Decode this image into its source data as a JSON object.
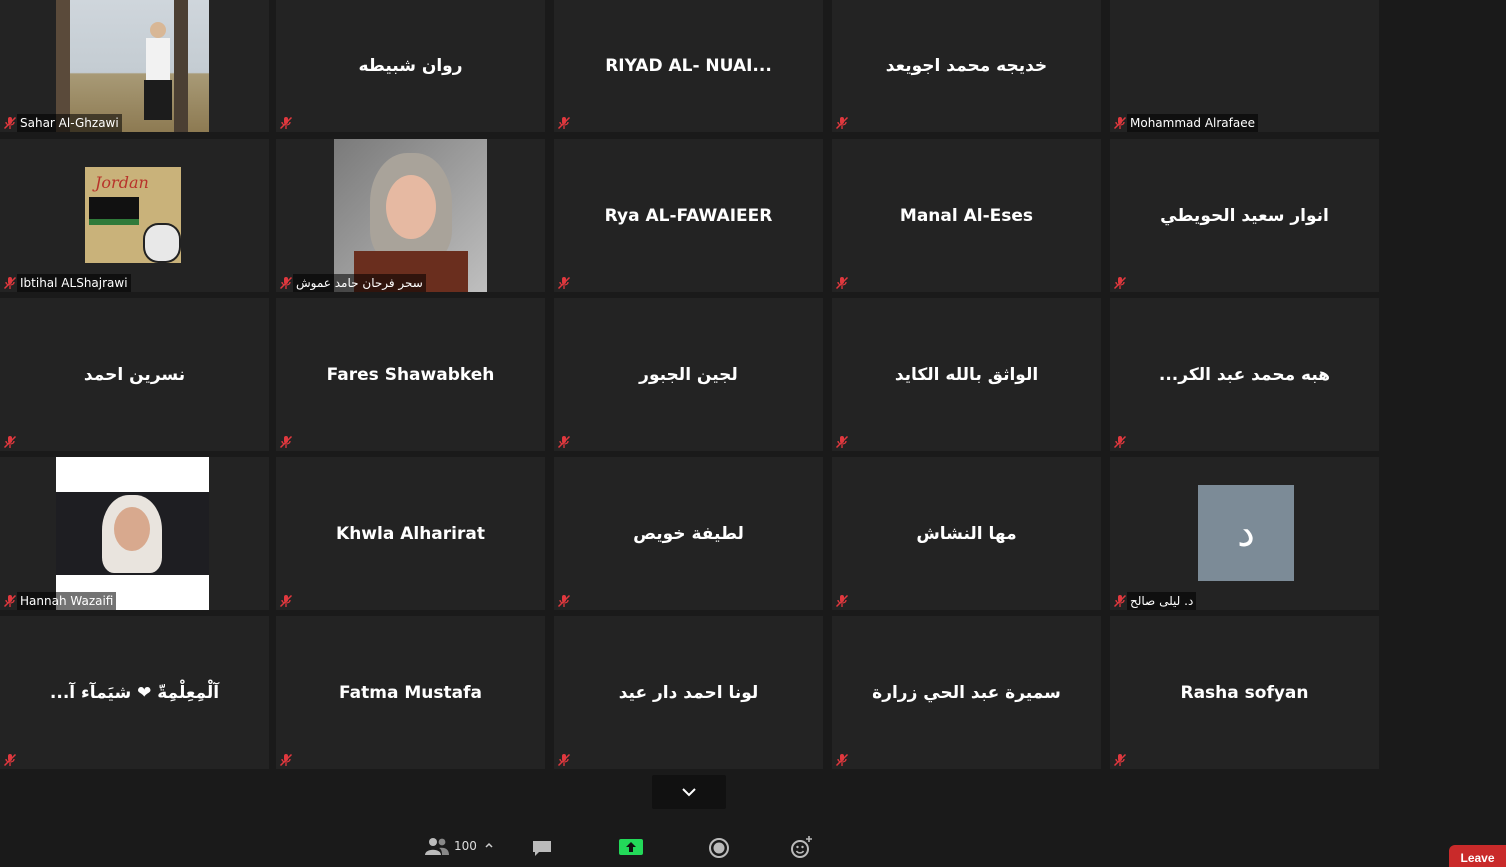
{
  "participants": [
    {
      "name": "Sahar Al-Ghzawi",
      "kind": "video"
    },
    {
      "name": "روان شبيطه",
      "kind": "name"
    },
    {
      "name": "RIYAD  AL-  NUAI...",
      "kind": "name"
    },
    {
      "name": "خديجه محمد اجويعد",
      "kind": "name"
    },
    {
      "name": "Mohammad Alrafaee",
      "kind": "video"
    },
    {
      "name": "Ibtihal ALShajrawi",
      "kind": "video"
    },
    {
      "name": "سحر فرحان حامد عموش",
      "kind": "video"
    },
    {
      "name": "Rya AL-FAWAIEER",
      "kind": "name"
    },
    {
      "name": "Manal Al-Eses",
      "kind": "name"
    },
    {
      "name": "انوار سعيد الحويطي",
      "kind": "name"
    },
    {
      "name": "نسرين احمد",
      "kind": "name"
    },
    {
      "name": "Fares Shawabkeh",
      "kind": "name"
    },
    {
      "name": "لجين الجبور",
      "kind": "name"
    },
    {
      "name": "الواثق بالله  الكايد",
      "kind": "name"
    },
    {
      "name": "...هبه محمد عبد الكر",
      "kind": "name"
    },
    {
      "name": "Hannah Wazaifi",
      "kind": "video"
    },
    {
      "name": "Khwla Alharirat",
      "kind": "name"
    },
    {
      "name": "لطيفة خويص",
      "kind": "name"
    },
    {
      "name": "مها النشاش",
      "kind": "name"
    },
    {
      "name": "د. ليلى صالح",
      "kind": "avatar",
      "avatar_letter": "د"
    },
    {
      "name": "...آلْمِعِلْمِةّ ❤ شيَمآء آ",
      "kind": "name"
    },
    {
      "name": "Fatma Mustafa",
      "kind": "name"
    },
    {
      "name": "لونا احمد دار عيد",
      "kind": "name"
    },
    {
      "name": "سميرة عبد الحي زرارة",
      "kind": "name"
    },
    {
      "name": "Rasha sofyan",
      "kind": "name"
    }
  ],
  "toolbar": {
    "participant_count": "100",
    "leave_label": "Leave"
  },
  "colors": {
    "tile_bg": "#232323",
    "mic_muted": "#e0383e",
    "share_green": "#23d959",
    "leave_red": "#c92a2a",
    "avatar_bg": "#7c8b97"
  }
}
